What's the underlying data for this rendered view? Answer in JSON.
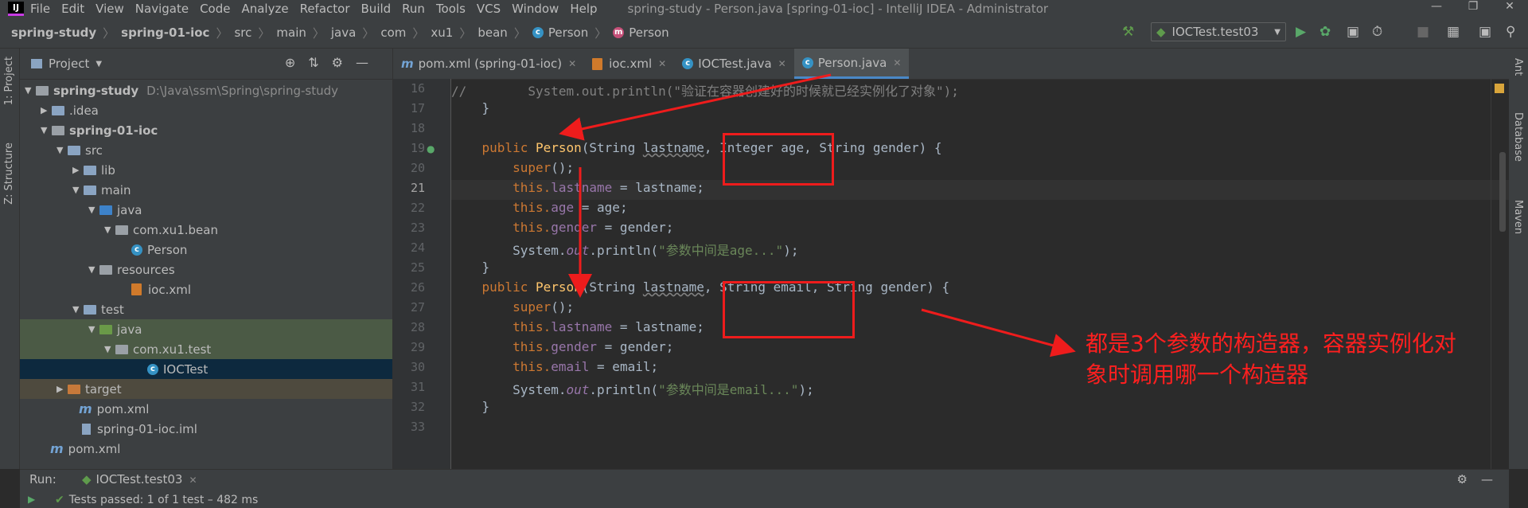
{
  "menu": {
    "items": [
      "File",
      "Edit",
      "View",
      "Navigate",
      "Code",
      "Analyze",
      "Refactor",
      "Build",
      "Run",
      "Tools",
      "VCS",
      "Window",
      "Help"
    ],
    "window_title": "spring-study - Person.java [spring-01-ioc] - IntelliJ IDEA - Administrator"
  },
  "breadcrumb": [
    "spring-study",
    "spring-01-ioc",
    "src",
    "main",
    "java",
    "com",
    "xu1",
    "bean",
    "Person",
    "Person"
  ],
  "run_config": "IOCTest.test03",
  "side_labels": {
    "project": "1: Project",
    "structure": "Z: Structure",
    "ant": "Ant",
    "database": "Database",
    "maven": "Maven"
  },
  "project_panel": {
    "title": "Project",
    "tree": [
      {
        "label": "spring-study",
        "extra": "D:\\Java\\ssm\\Spring\\spring-study",
        "bold": true
      },
      {
        "label": ".idea"
      },
      {
        "label": "spring-01-ioc",
        "bold": true
      },
      {
        "label": "src"
      },
      {
        "label": "lib"
      },
      {
        "label": "main"
      },
      {
        "label": "java"
      },
      {
        "label": "com.xu1.bean"
      },
      {
        "label": "Person"
      },
      {
        "label": "resources"
      },
      {
        "label": "ioc.xml"
      },
      {
        "label": "test"
      },
      {
        "label": "java"
      },
      {
        "label": "com.xu1.test"
      },
      {
        "label": "IOCTest"
      },
      {
        "label": "target"
      },
      {
        "label": "pom.xml"
      },
      {
        "label": "spring-01-ioc.iml"
      },
      {
        "label": "pom.xml"
      }
    ]
  },
  "editor": {
    "tabs": [
      {
        "label": "pom.xml (spring-01-ioc)"
      },
      {
        "label": "ioc.xml"
      },
      {
        "label": "IOCTest.java"
      },
      {
        "label": "Person.java"
      }
    ],
    "line_numbers": [
      "16",
      "17",
      "18",
      "19",
      "20",
      "21",
      "22",
      "23",
      "24",
      "25",
      "26",
      "27",
      "28",
      "29",
      "30",
      "31",
      "32",
      "33"
    ],
    "code": {
      "l16_comment": "//        System.out.println(\"验证在容器创建好的时候就已经实例化了对象\");",
      "brace": "}",
      "kw_public": "public",
      "ctor_name": "Person",
      "ctor1_params_a": "(String ",
      "p_lastname": "lastname",
      "ctor1_params_b": ", Integer age, String gender) {",
      "ctor2_params_b": ", String email, String gender) {",
      "super_call": "super",
      "super_rest": "();",
      "kw_this": "this.",
      "f_lastname": "lastname",
      "f_age": "age",
      "f_gender": "gender",
      "f_email": "email",
      "assign_lastname": " = lastname;",
      "assign_age": " = age;",
      "assign_gender": " = gender;",
      "assign_email": " = email;",
      "sysout_a": "System.",
      "sysout_out": "out",
      "sysout_b": ".println(",
      "str_age": "\"参数中间是age...\"",
      "str_email": "\"参数中间是email...\"",
      "close_paren": ");"
    }
  },
  "annotation": {
    "line1": "都是3个参数的构造器，容器实例化对",
    "line2": "象时调用哪一个构造器"
  },
  "run_panel": {
    "label": "Run:",
    "tab": "IOCTest.test03",
    "status": "Tests passed: 1 of 1 test – 482 ms"
  }
}
